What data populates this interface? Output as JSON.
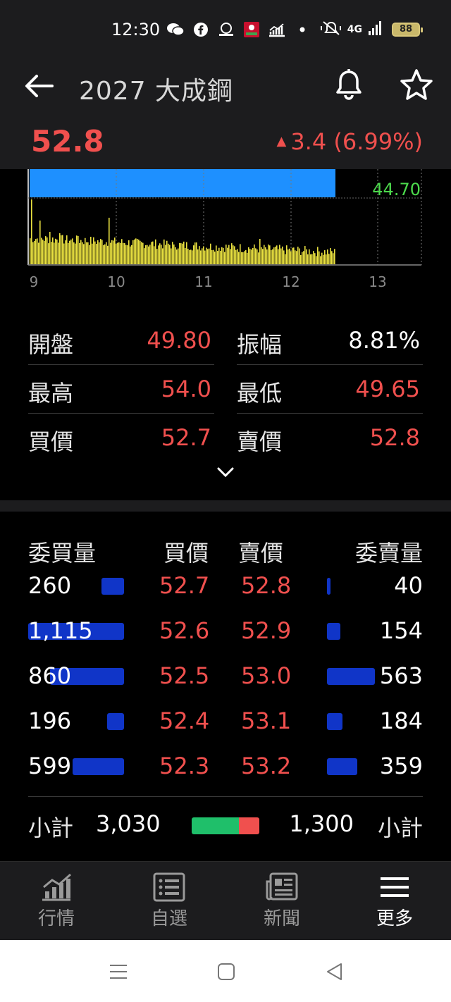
{
  "status_bar": {
    "time": "12:30",
    "network": "4G",
    "battery": "88"
  },
  "header": {
    "title": "2027 大成鋼",
    "price": "52.8",
    "change": "3.4 (6.99%)",
    "up_color": "#f0504e"
  },
  "chart": {
    "price_label": "44.70",
    "x_ticks": [
      "9",
      "10",
      "11",
      "12",
      "13"
    ]
  },
  "chart_data": {
    "type": "bar",
    "x_ticks": [
      "9",
      "10",
      "11",
      "12",
      "13"
    ],
    "price_label": "44.70",
    "volume_color": "#e8e040",
    "price_band_color": "#1e90ff"
  },
  "stats": {
    "rows": [
      {
        "l_label": "開盤",
        "l_value": "49.80",
        "r_label": "振幅",
        "r_value": "8.81%"
      },
      {
        "l_label": "最高",
        "l_value": "54.0",
        "r_label": "最低",
        "r_value": "49.65"
      },
      {
        "l_label": "買價",
        "l_value": "52.7",
        "r_label": "賣價",
        "r_value": "52.8"
      }
    ]
  },
  "order_book": {
    "headers": {
      "bid_vol": "委買量",
      "bid_price": "買價",
      "ask_price": "賣價",
      "ask_vol": "委賣量"
    },
    "rows": [
      {
        "bid_vol": "260",
        "bid_vol_n": 260,
        "bid_price": "52.7",
        "ask_price": "52.8",
        "ask_vol": "40",
        "ask_vol_n": 40
      },
      {
        "bid_vol": "1,115",
        "bid_vol_n": 1115,
        "bid_price": "52.6",
        "ask_price": "52.9",
        "ask_vol": "154",
        "ask_vol_n": 154
      },
      {
        "bid_vol": "860",
        "bid_vol_n": 860,
        "bid_price": "52.5",
        "ask_price": "53.0",
        "ask_vol": "563",
        "ask_vol_n": 563
      },
      {
        "bid_vol": "196",
        "bid_vol_n": 196,
        "bid_price": "52.4",
        "ask_price": "53.1",
        "ask_vol": "184",
        "ask_vol_n": 184
      },
      {
        "bid_vol": "599",
        "bid_vol_n": 599,
        "bid_price": "52.3",
        "ask_price": "53.2",
        "ask_vol": "359",
        "ask_vol_n": 359
      }
    ],
    "subtotal": {
      "label": "小計",
      "bid_total": "3,030",
      "ask_total": "1,300",
      "bid_total_n": 3030,
      "ask_total_n": 1300
    },
    "bar_color": "#1035c8"
  },
  "bottom_nav": {
    "items": [
      {
        "label": "行情",
        "icon": "chart-icon"
      },
      {
        "label": "自選",
        "icon": "list-icon"
      },
      {
        "label": "新聞",
        "icon": "news-icon"
      },
      {
        "label": "更多",
        "icon": "menu-icon"
      }
    ],
    "active": 3
  }
}
